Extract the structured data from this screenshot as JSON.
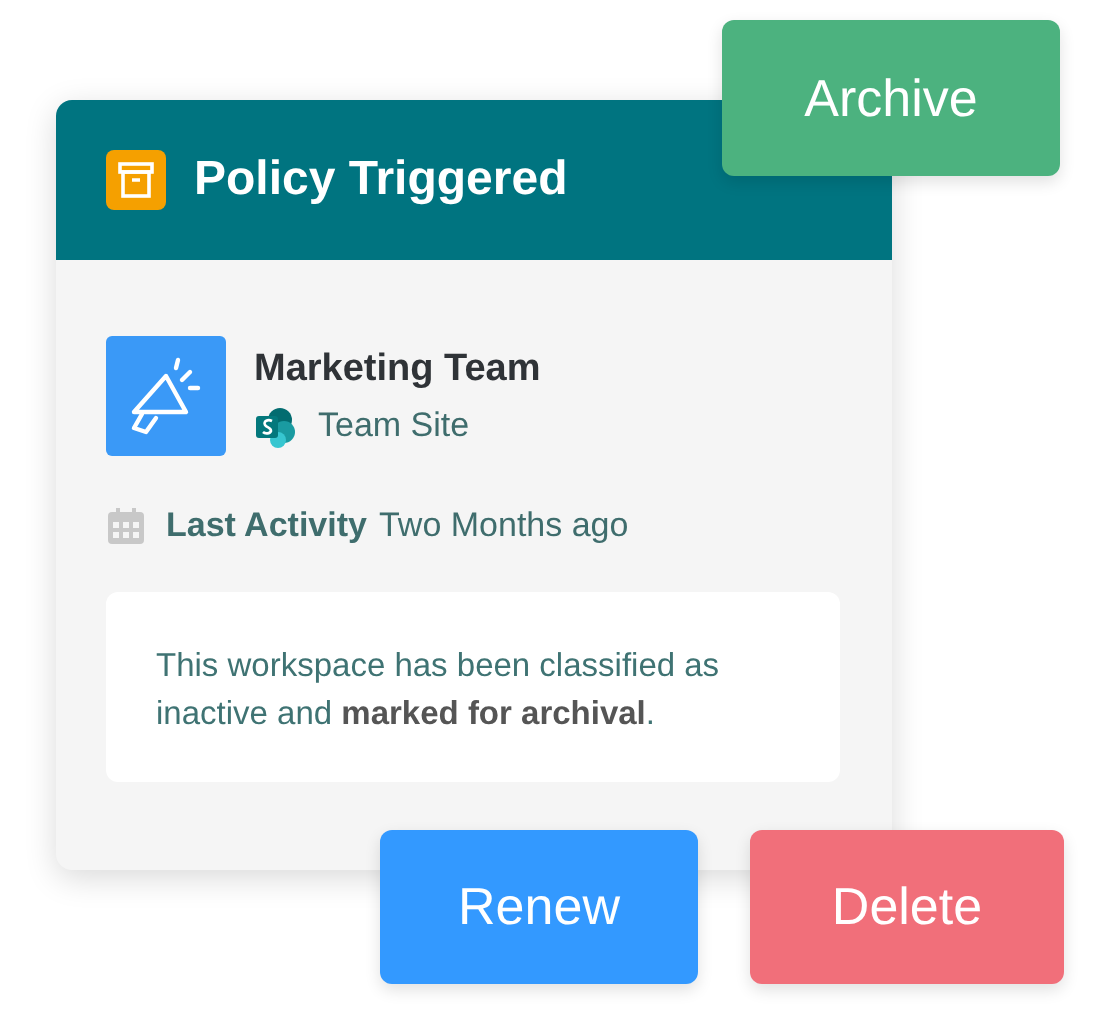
{
  "card": {
    "title": "Policy Triggered",
    "workspace": {
      "name": "Marketing Team",
      "type": "Team Site"
    },
    "activity": {
      "label": "Last Activity",
      "value": "Two Months ago"
    },
    "message": "This workspace has been classified as inactive and **marked for archival**."
  },
  "actions": [
    {
      "label": "Archive",
      "kind": "archive"
    },
    {
      "label": "Renew",
      "kind": "renew"
    },
    {
      "label": "Delete",
      "kind": "delete"
    }
  ]
}
